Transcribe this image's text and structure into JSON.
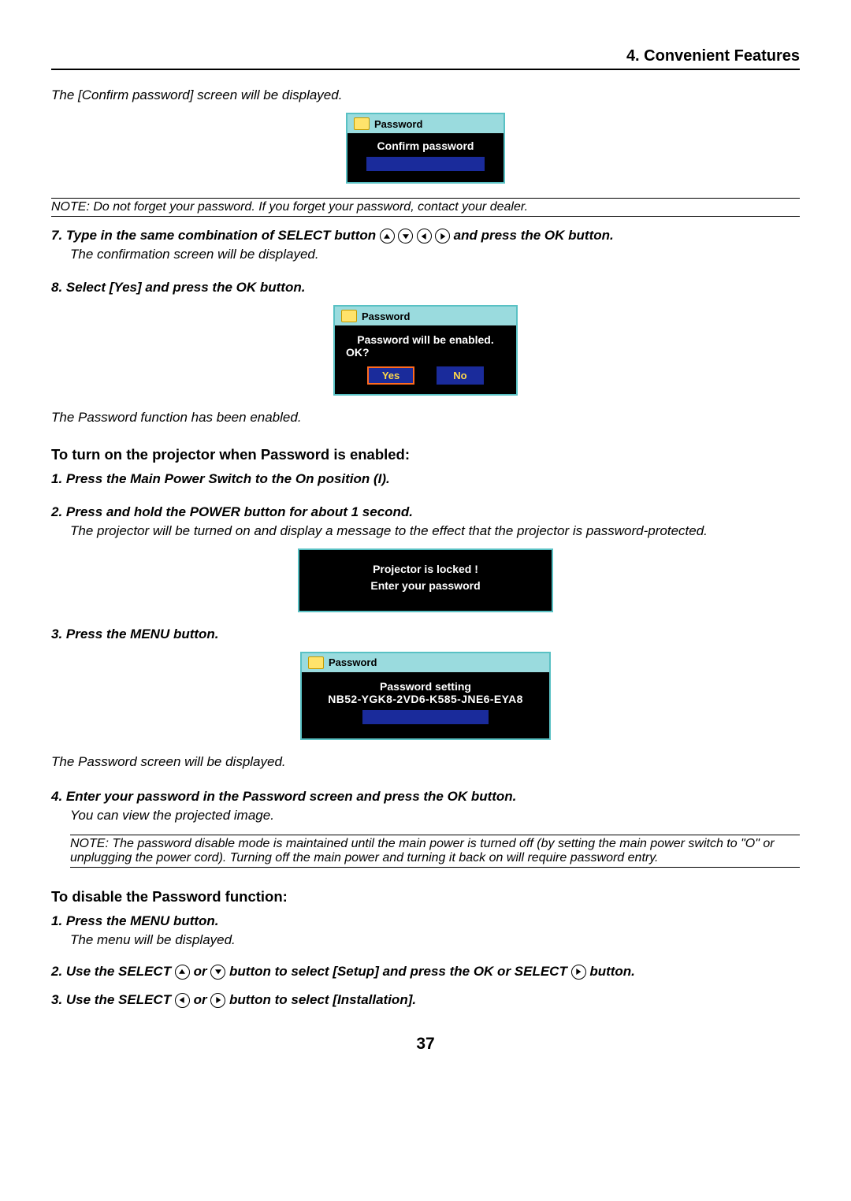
{
  "header": {
    "section_title": "4. Convenient Features"
  },
  "intro": {
    "line1": "The [Confirm password] screen will be displayed."
  },
  "dialog1": {
    "title": "Password",
    "body": "Confirm password"
  },
  "note1": "NOTE: Do not forget your password. If you forget your password, contact your dealer.",
  "step7": {
    "lead": "7.  Type in the same combination of SELECT button ",
    "trail": "  and press the OK button.",
    "sub": "The confirmation screen will be displayed."
  },
  "step8": {
    "lead": "8.  Select [Yes] and press the OK button."
  },
  "dialog2": {
    "title": "Password",
    "line1": "Password will be enabled.",
    "line2": "OK?",
    "yes": "Yes",
    "no": "No"
  },
  "after2": "The Password function has been enabled.",
  "heading_turnon": "To turn on the projector when Password is enabled:",
  "on_step1": "1.  Press the Main Power Switch to the On position (I).",
  "on_step2": {
    "lead": "2.  Press and hold the POWER  button for about 1 second.",
    "sub": "The projector will be turned on and display a message to the effect that the projector is password-protected."
  },
  "dialog3": {
    "line1": "Projector is locked !",
    "line2": "Enter your password"
  },
  "on_step3": "3.  Press the MENU button.",
  "dialog4": {
    "title": "Password",
    "line1": "Password setting",
    "code": "NB52-YGK8-2VD6-K585-JNE6-EYA8"
  },
  "after4": "The Password screen will be displayed.",
  "on_step4": {
    "lead": "4.  Enter your password in the Password screen and press the OK button.",
    "sub": "You can view the projected image."
  },
  "note2": "NOTE: The password disable mode is maintained until the main power is turned off (by setting the main power switch to \"O\" or unplugging the power cord). Turning off the main power and turning it back on will require password entry.",
  "heading_disable": "To disable the Password function:",
  "dis_step1": {
    "lead": "1.  Press the MENU button.",
    "sub": "The menu will be displayed."
  },
  "dis_step2": {
    "lead_a": "2.  Use the SELECT ",
    "lead_b": " or ",
    "lead_c": " button to select [Setup] and press the OK or SELECT ",
    "lead_d": " button."
  },
  "dis_step3": {
    "lead_a": "3.  Use the SELECT ",
    "lead_b": " or ",
    "lead_c": " button to select [Installation]."
  },
  "page_number": "37"
}
